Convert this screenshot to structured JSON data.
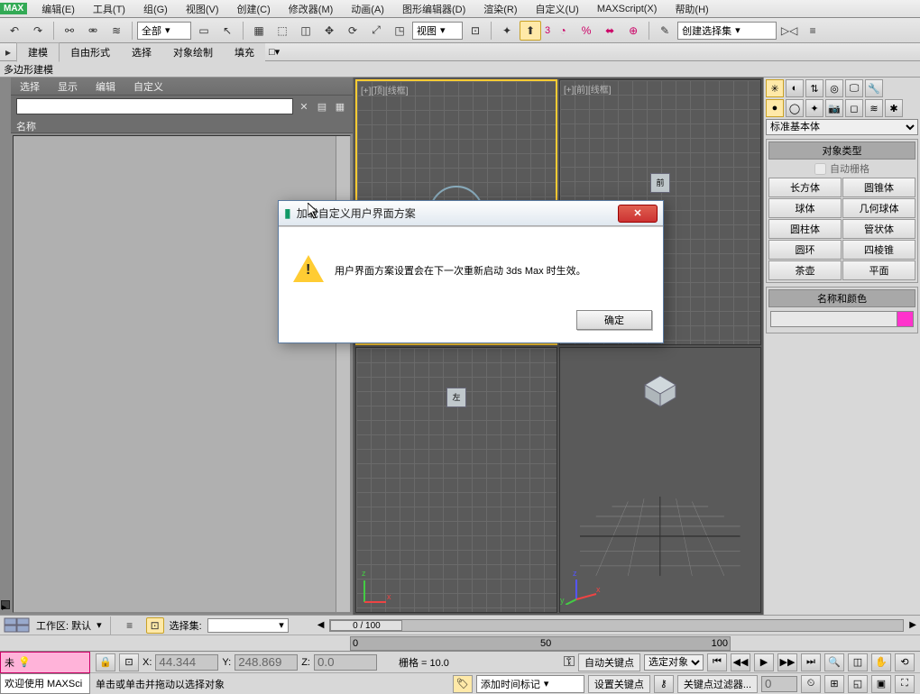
{
  "app": {
    "name": "MAX"
  },
  "menu": [
    "编辑(E)",
    "工具(T)",
    "组(G)",
    "视图(V)",
    "创建(C)",
    "修改器(M)",
    "动画(A)",
    "图形编辑器(D)",
    "渲染(R)",
    "自定义(U)",
    "MAXScript(X)",
    "帮助(H)"
  ],
  "toolbar": {
    "coord_filter": "全部",
    "view_dropdown": "视图",
    "ref_number": "3",
    "selection_set": "创建选择集"
  },
  "shelf": {
    "tabs": [
      "建模",
      "自由形式",
      "选择",
      "对象绘制",
      "填充"
    ]
  },
  "subshelf": {
    "label": "多边形建模"
  },
  "left_panel": {
    "tabs": [
      "选择",
      "显示",
      "编辑",
      "自定义"
    ],
    "search_placeholder": "",
    "column_header": "名称"
  },
  "viewports": {
    "vp1": "[+][顶][线框]",
    "vp2": "[+][前][线框]"
  },
  "right_panel": {
    "primitive_dropdown": "标准基本体",
    "object_type_title": "对象类型",
    "auto_grid": "自动栅格",
    "objects": [
      "长方体",
      "圆锥体",
      "球体",
      "几何球体",
      "圆柱体",
      "管状体",
      "圆环",
      "四棱锥",
      "茶壶",
      "平面"
    ],
    "name_color_title": "名称和颜色"
  },
  "timeline": {
    "frame_display": "0 / 100",
    "start": "0",
    "mid": "50",
    "end": "100"
  },
  "status": {
    "workspace_label": "工作区: 默认",
    "selection_set_label": "选择集:",
    "unsaved": "未",
    "x_label": "X:",
    "x_value": "44.344",
    "y_label": "Y:",
    "y_value": "248.869",
    "z_label": "Z:",
    "z_value": "0.0",
    "grid_label": "栅格 = 10.0",
    "add_marker": "添加时间标记",
    "auto_key": "自动关键点",
    "set_key": "设置关键点",
    "sel_obj": "选定对象",
    "key_filter": "关键点过滤器..."
  },
  "footer": {
    "welcome": "欢迎使用  MAXSci",
    "hint": "单击或单击并拖动以选择对象"
  },
  "dialog": {
    "title": "加载自定义用户界面方案",
    "message": "用户界面方案设置会在下一次重新启动 3ds Max 时生效。",
    "ok": "确定"
  }
}
